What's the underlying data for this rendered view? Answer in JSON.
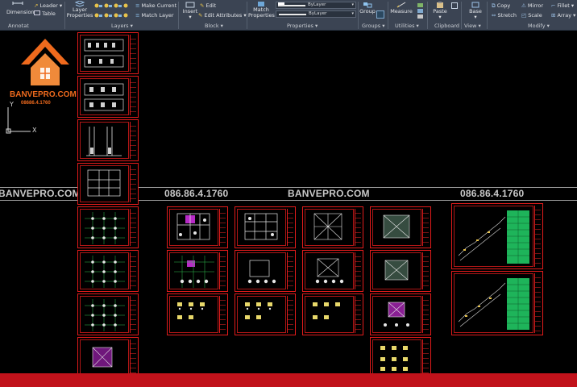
{
  "ribbon": {
    "annotation": {
      "panel_label": "Annotat",
      "dimension_label": "Dimension",
      "leader_label": "Leader",
      "table_label": "Table"
    },
    "layers": {
      "panel_label": "Layers",
      "layer_properties_label": "Layer Properties",
      "make_current_label": "Make Current",
      "match_layer_label": "Match Layer"
    },
    "block": {
      "panel_label": "Block",
      "insert_label": "Insert",
      "edit_label": "Edit",
      "edit_attributes_label": "Edit Attributes"
    },
    "properties": {
      "panel_label": "Properties",
      "match_properties_label": "Match Properties",
      "color_value": "",
      "linetype_value": "ByLayer",
      "lineweight_value": "ByLayer"
    },
    "groups": {
      "panel_label": "Groups",
      "group_label": "Group"
    },
    "utilities": {
      "panel_label": "Utilities",
      "measure_label": "Measure"
    },
    "clipboard": {
      "panel_label": "Clipboard",
      "paste_label": "Paste"
    },
    "view": {
      "panel_label": "View",
      "base_label": "Base"
    },
    "modify": {
      "panel_label": "Modify",
      "copy_label": "Copy",
      "mirror_label": "Mirror",
      "fillet_label": "Fillet",
      "stretch_label": "Stretch",
      "scale_label": "Scale",
      "array_label": "Array"
    },
    "dropdown_glyph": "▾"
  },
  "logo": {
    "name": "BANVEPRO.COM",
    "phone": "08686.4.1760"
  },
  "ucs": {
    "x_label": "X",
    "y_label": "Y"
  },
  "watermark": {
    "left_text": "BANVEPRO.COM",
    "phone_1": "086.86.4.1760",
    "center_text": "BANVEPRO.COM",
    "phone_2": "086.86.4.1760"
  },
  "colors": {
    "ribbon_bg": "#3b4453",
    "canvas_bg": "#000000",
    "sheet_border": "#e21b1b",
    "brand_orange": "#ef6a1d",
    "bottom_band": "#c1121b"
  }
}
